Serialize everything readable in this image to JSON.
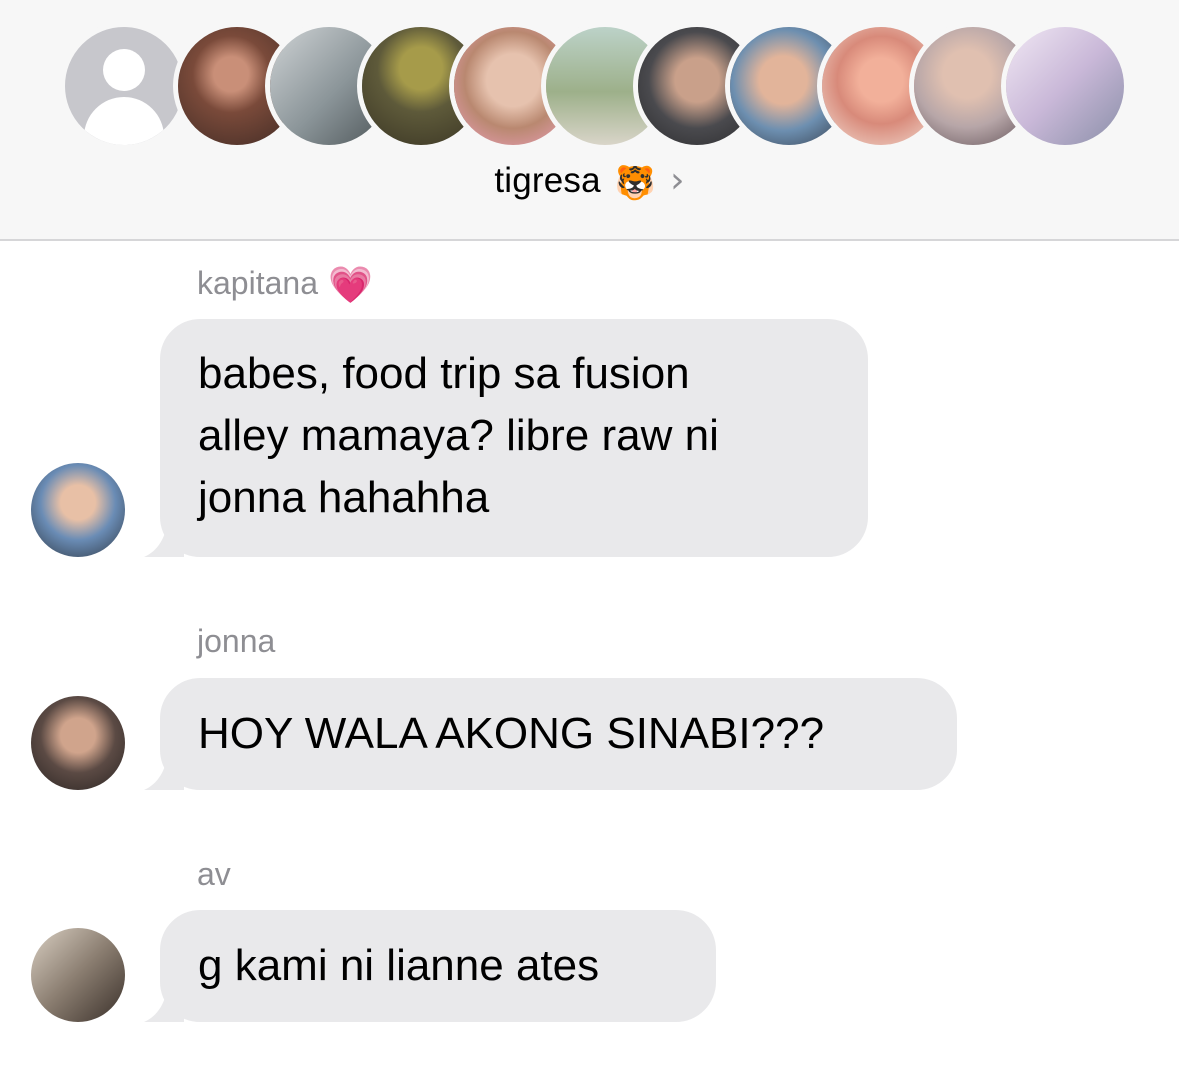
{
  "header": {
    "group_name": "tigresa",
    "group_emoji": "🐯",
    "chevron": "›",
    "participants": [
      {
        "name": "placeholder-avatar",
        "color": "#c7c7cc"
      },
      {
        "name": "participant-avatar-1",
        "color": "#7a4a3a"
      },
      {
        "name": "participant-avatar-2",
        "color": "#9aa3a8"
      },
      {
        "name": "participant-avatar-3",
        "color": "#6f6a3e"
      },
      {
        "name": "participant-avatar-4",
        "color": "#d8b4a0"
      },
      {
        "name": "participant-avatar-5",
        "color": "#9db08a"
      },
      {
        "name": "participant-avatar-6",
        "color": "#4a4a4e"
      },
      {
        "name": "participant-avatar-7",
        "color": "#6d8fb0"
      },
      {
        "name": "participant-avatar-8",
        "color": "#d88a7a"
      },
      {
        "name": "participant-avatar-9",
        "color": "#b7a6a8"
      },
      {
        "name": "participant-avatar-10",
        "color": "#c9b8d8"
      }
    ]
  },
  "messages": [
    {
      "sender": "kapitana",
      "sender_emoji": "💗",
      "lines": [
        "babes, food trip sa fusion",
        "alley mamaya? libre raw ni",
        "jonna hahahha"
      ],
      "avatar_color": "#6a8cb5"
    },
    {
      "sender": "jonna",
      "lines": [
        "HOY WALA AKONG SINABI???"
      ],
      "avatar_color": "#5b4a44"
    },
    {
      "sender": "av",
      "lines": [
        "g kami ni lianne ates"
      ],
      "avatar_color": "#8a7d70"
    }
  ]
}
